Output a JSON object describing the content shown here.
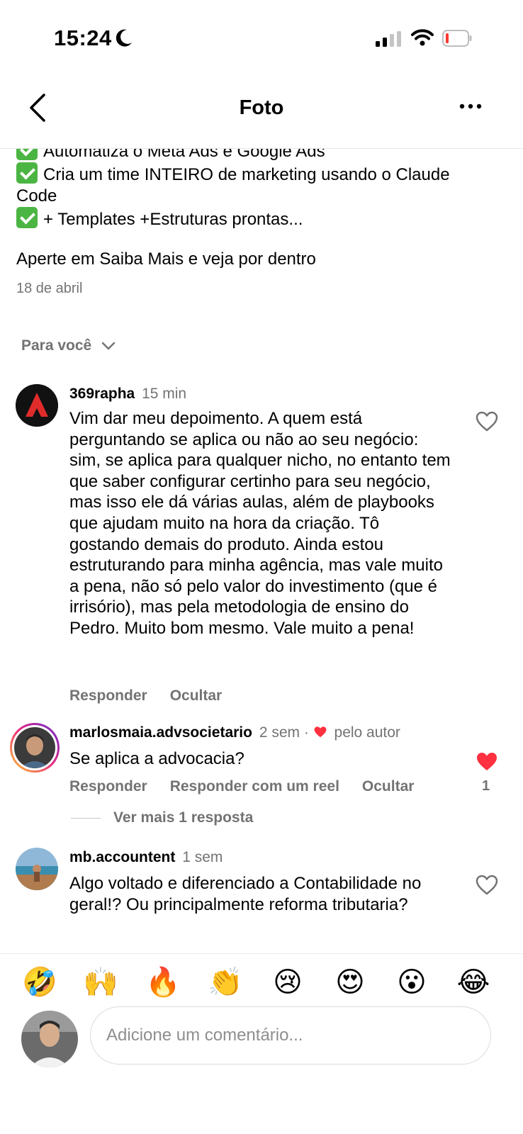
{
  "status": {
    "time": "15:24"
  },
  "header": {
    "title": "Foto"
  },
  "caption": {
    "lines": [
      "Automatiza o Meta Ads e Google Ads",
      "Cria um time INTEIRO de marketing usando o Claude",
      "Code",
      "+ Templates +Estruturas prontas..."
    ],
    "cta": "Aperte em Saiba Mais e veja por dentro",
    "date": "18 de abril"
  },
  "filter": {
    "label": "Para você"
  },
  "comments": [
    {
      "user": "369rapha",
      "meta": "15 min",
      "text": "Vim dar meu depoimento. A quem está perguntando se aplica ou não ao seu negócio: sim, se aplica para qualquer nicho, no entanto tem que saber configurar certinho para seu negócio, mas isso ele dá várias aulas, além de playbooks que ajudam muito na hora da criação. Tô gostando demais do produto. Ainda estou estruturando para minha agência, mas vale muito a pena, não só pelo valor do investimento (que é irrisório), mas pela metodologia de ensino do Pedro. Muito bom mesmo. Vale muito a pena!",
      "reply_label": "Responder",
      "hide_label": "Ocultar"
    },
    {
      "user": "marlosmaia.advsocietario",
      "meta": "2 sem ·",
      "liked_by": "pelo autor",
      "text": "Se aplica a advocacia?",
      "reply_label": "Responder",
      "reel_label": "Responder com um reel",
      "hide_label": "Ocultar",
      "like_count": "1",
      "more_replies": "Ver mais 1 resposta"
    },
    {
      "user": "mb.accountent",
      "meta": "1 sem",
      "text": "Algo voltado e diferenciado a Contabilidade no geral!? Ou principalmente reforma tributaria?"
    }
  ],
  "reactions": [
    "🤣",
    "🙌",
    "🔥",
    "👏",
    "😢",
    "😍",
    "😮",
    "😂"
  ],
  "composer": {
    "placeholder": "Adicione um comentário..."
  },
  "colors": {
    "like_red": "#ff3040",
    "meta_gray": "#737373",
    "check_green": "#4bb543"
  }
}
